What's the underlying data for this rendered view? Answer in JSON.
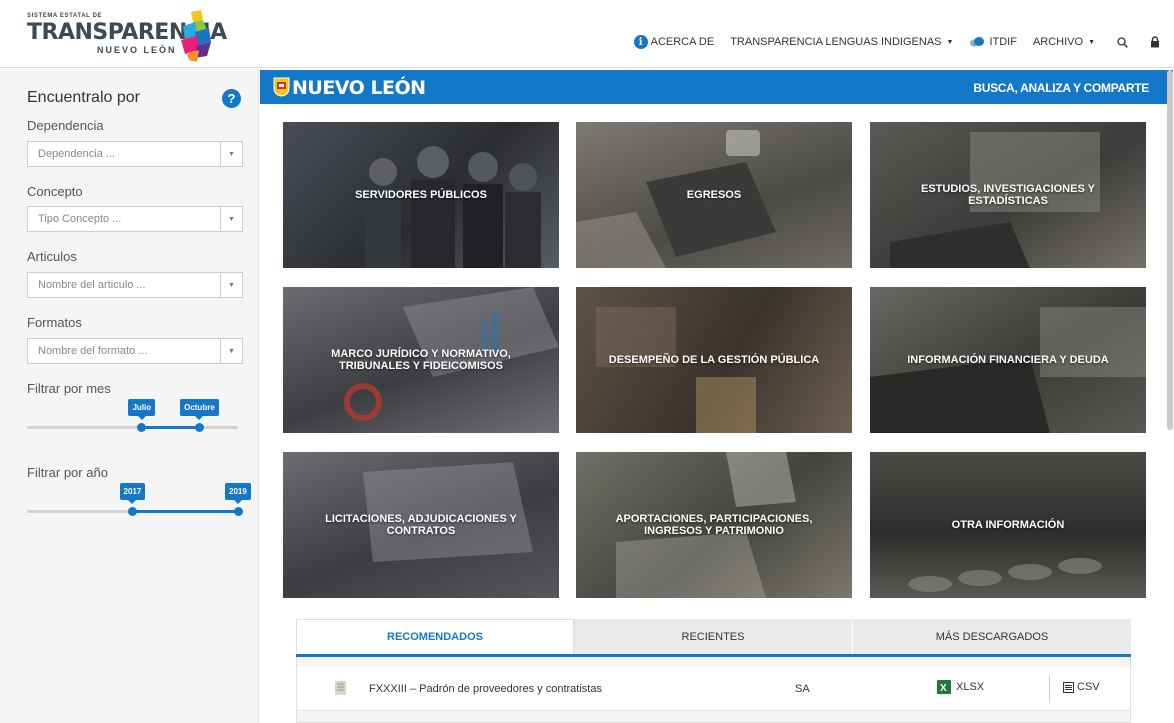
{
  "brand": {
    "small": "SISTEMA ESTATAL DE",
    "main": "TRANSPARENCIA",
    "sub": "NUEVO LEÓN"
  },
  "nav": {
    "about": "ACERCA DE",
    "indigenous": "TRANSPARENCIA LENGUAS INDIGENAS",
    "itdif": "ITDIF",
    "archive": "ARCHIVO"
  },
  "sidebar": {
    "title": "Encuentralo por",
    "filters": [
      {
        "label": "Dependencia",
        "placeholder": "Dependencia ..."
      },
      {
        "label": "Concepto",
        "placeholder": "Tipo Concepto ..."
      },
      {
        "label": "Articulos",
        "placeholder": "Nombre del articulo ..."
      },
      {
        "label": "Formatos",
        "placeholder": "Nombre del formato ..."
      }
    ],
    "month_filter": {
      "label": "Filtrar por mes",
      "from": "Julio",
      "to": "Octubre",
      "from_fraction": 0.545,
      "to_fraction": 0.818
    },
    "year_filter": {
      "label": "Filtrar por año",
      "from": "2017",
      "to": "2019",
      "from_fraction": 0.5,
      "to_fraction": 1.0
    }
  },
  "banner": {
    "title": "NUEVO LEÓN",
    "slogan": "BUSCA, ANALIZA Y COMPARTE"
  },
  "tiles": [
    "SERVIDORES PÚBLICOS",
    "EGRESOS",
    "ESTUDIOS, INVESTIGACIONES Y ESTADÍSTICAS",
    "MARCO JURÍDICO Y NORMATIVO, TRIBUNALES Y FIDEICOMISOS",
    "DESEMPEÑO DE LA GESTIÓN PÚBLICA",
    "INFORMACIÓN FINANCIERA Y DEUDA",
    "LICITACIONES, ADJUDICACIONES Y CONTRATOS",
    "APORTACIONES, PARTICIPACIONES, INGRESOS Y PATRIMONIO",
    "OTRA INFORMACIÓN"
  ],
  "tabs": [
    "RECOMENDADOS",
    "RECIENTES",
    "MÁS DESCARGADOS"
  ],
  "active_tab": 0,
  "rows": [
    {
      "name": "FXXXIII – Padrón de proveedores y contratistas",
      "dependency": "SA",
      "xlsx": "XLSX",
      "csv": "CSV"
    }
  ],
  "colors": {
    "accent": "#1478c8",
    "sidebar_bg": "#f5f5f5",
    "excel": "#1f7a3a"
  },
  "icons": {
    "about": "info-icon",
    "itdif": "cloud-icon",
    "search": "search-icon",
    "lock": "lock-icon",
    "help": "help-icon"
  }
}
